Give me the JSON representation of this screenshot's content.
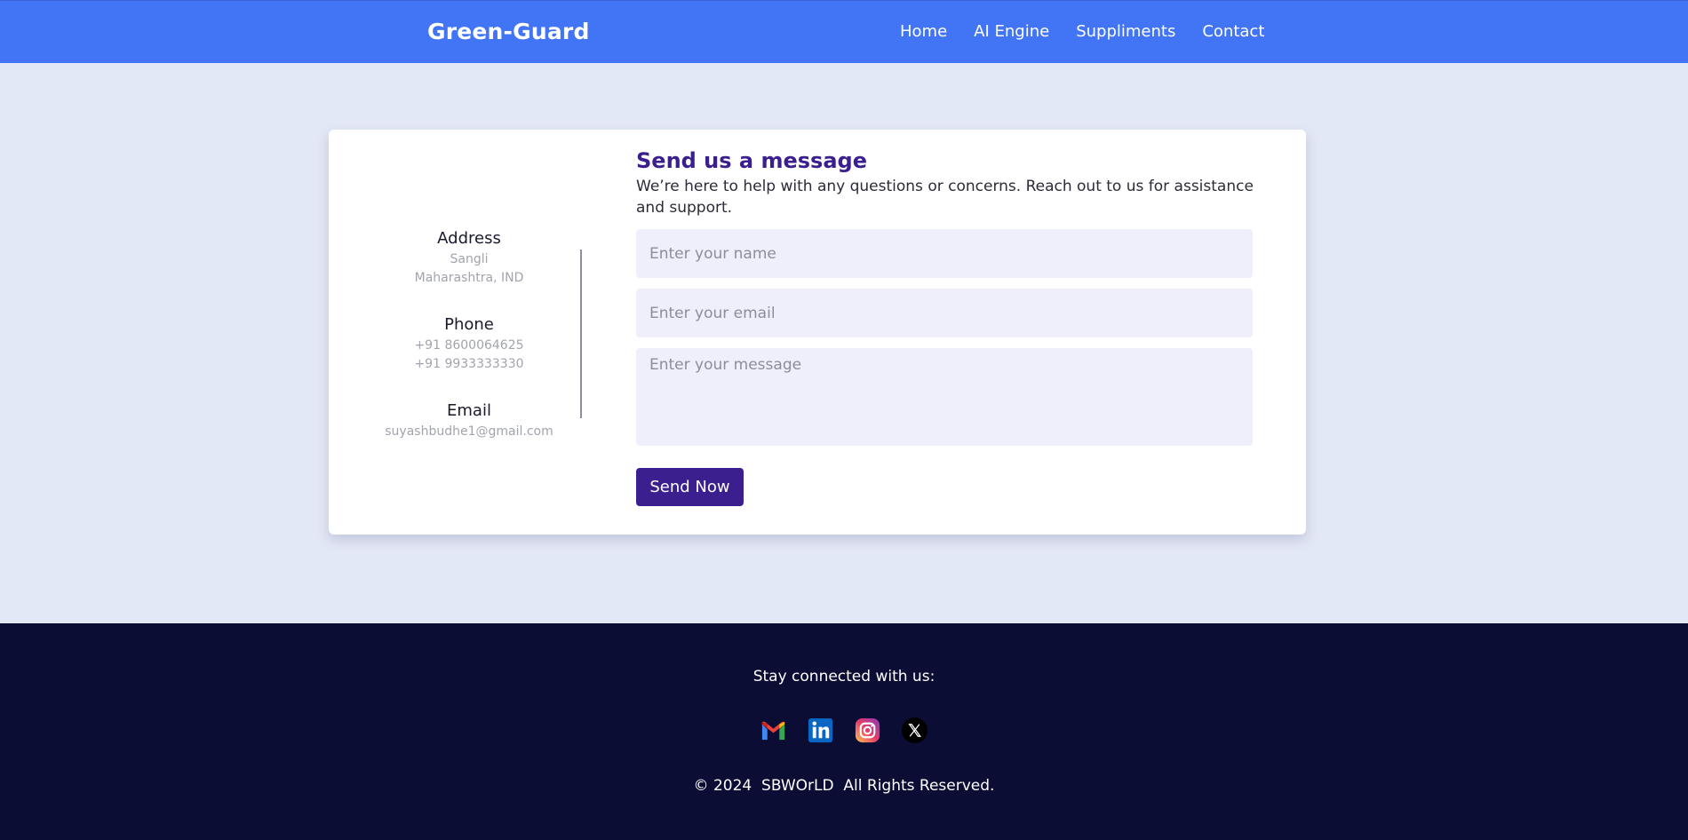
{
  "navbar": {
    "brand": "Green-Guard",
    "links": [
      "Home",
      "AI Engine",
      "Suppliments",
      "Contact"
    ],
    "background": "#4275f5"
  },
  "contact_info": {
    "address": {
      "title": "Address",
      "lines": [
        "Sangli",
        "Maharashtra, IND"
      ]
    },
    "phone": {
      "title": "Phone",
      "lines": [
        "+91 8600064625",
        "+91 9933333330"
      ]
    },
    "email": {
      "title": "Email",
      "lines": [
        "suyashbudhe1@gmail.com"
      ]
    }
  },
  "form": {
    "title": "Send us a message",
    "description": "We’re here to help with any questions or concerns. Reach out to us for assistance and support.",
    "name_placeholder": "Enter your name",
    "email_placeholder": "Enter your email",
    "message_placeholder": "Enter your message",
    "submit_label": "Send Now",
    "accent": "#3b1f8f"
  },
  "footer": {
    "heading": "Stay connected with us:",
    "social_icons": [
      "gmail-icon",
      "linkedin-icon",
      "instagram-icon",
      "x-icon"
    ],
    "copyright": "© 2024  SBWOrLD  All Rights Reserved.",
    "background": "#0b0d35"
  }
}
